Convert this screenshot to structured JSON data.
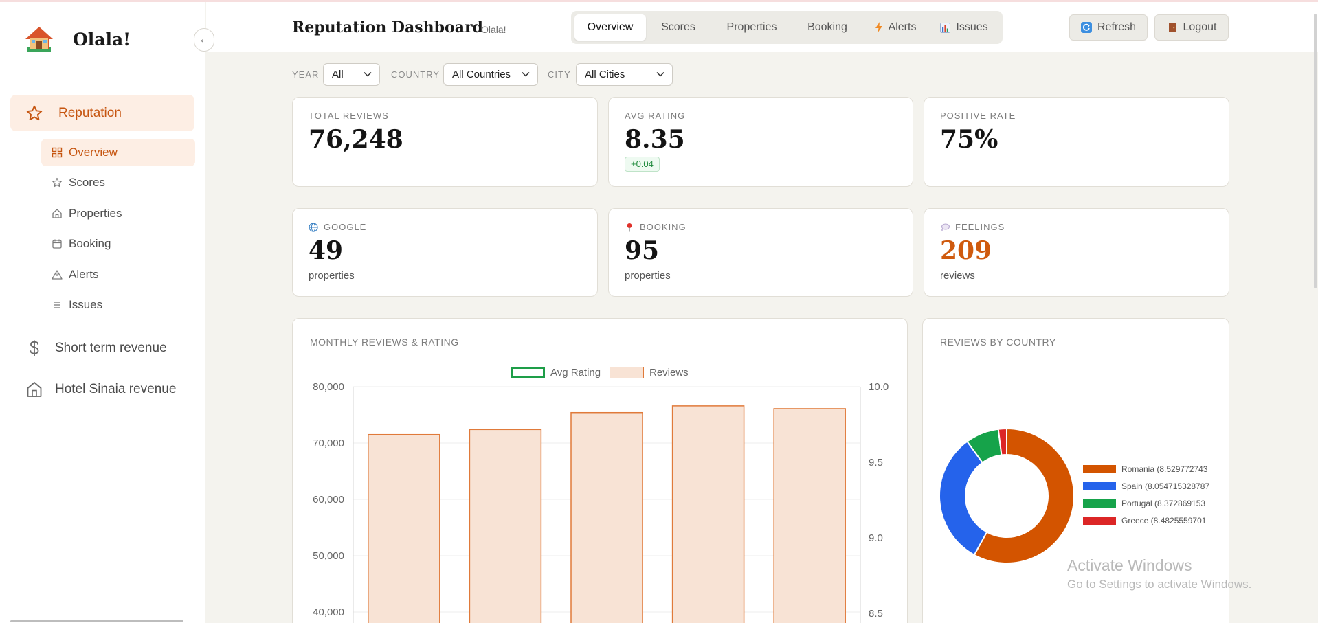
{
  "app": {
    "name": "Olala!"
  },
  "sidebar": {
    "collapse_glyph": "←",
    "group": {
      "label": "Reputation",
      "icon": "star-icon"
    },
    "sub_items": [
      {
        "label": "Overview",
        "icon": "grid-icon",
        "active": true
      },
      {
        "label": "Scores",
        "icon": "star-icon"
      },
      {
        "label": "Properties",
        "icon": "home-icon"
      },
      {
        "label": "Booking",
        "icon": "calendar-icon"
      },
      {
        "label": "Alerts",
        "icon": "warning-icon"
      },
      {
        "label": "Issues",
        "icon": "list-icon"
      }
    ],
    "main_items": [
      {
        "label": "Short term revenue",
        "icon": "dollar-icon"
      },
      {
        "label": "Hotel Sinaia revenue",
        "icon": "home-icon"
      }
    ]
  },
  "header": {
    "title": "Reputation Dashboard",
    "subtitle": "Olala!",
    "tabs": [
      {
        "label": "Overview",
        "active": true
      },
      {
        "label": "Scores"
      },
      {
        "label": "Properties"
      },
      {
        "label": "Booking"
      },
      {
        "label": "Alerts",
        "icon": "bolt-icon"
      },
      {
        "label": "Issues",
        "icon": "bar-chart-icon"
      }
    ],
    "refresh_label": "Refresh",
    "logout_label": "Logout"
  },
  "filters": {
    "year": {
      "label": "YEAR",
      "value": "All"
    },
    "country": {
      "label": "COUNTRY",
      "value": "All Countries"
    },
    "city": {
      "label": "CITY",
      "value": "All Cities"
    }
  },
  "stats": {
    "total_reviews": {
      "label": "TOTAL REVIEWS",
      "value": "76,248"
    },
    "avg_rating": {
      "label": "AVG RATING",
      "value": "8.35",
      "delta": "+0.04"
    },
    "positive_rate": {
      "label": "POSITIVE RATE",
      "value": "75%"
    },
    "google": {
      "label": "GOOGLE",
      "value": "49",
      "unit": "properties"
    },
    "booking": {
      "label": "BOOKING",
      "value": "95",
      "unit": "properties"
    },
    "feelings": {
      "label": "FEELINGS",
      "value": "209",
      "unit": "reviews"
    }
  },
  "colors": {
    "accent": "#cf5a0e",
    "bar_fill": "#f8e3d5",
    "bar_stroke": "#e07a3a",
    "avg_line": "#1e9e48",
    "romania": "#d35400",
    "spain": "#2563eb",
    "portugal": "#16a34a",
    "greece": "#dc2626"
  },
  "chart_data": [
    {
      "type": "bar",
      "title": "MONTHLY REVIEWS & RATING",
      "legend": [
        "Avg Rating",
        "Reviews"
      ],
      "legend_position": "top",
      "series": [
        {
          "name": "Reviews",
          "values": [
            71500,
            72400,
            75400,
            76600,
            76100
          ]
        }
      ],
      "y_left": {
        "ticks": [
          "80,000",
          "70,000",
          "60,000",
          "50,000",
          "40,000"
        ],
        "visible_range": [
          40000,
          80000
        ]
      },
      "y_right": {
        "ticks": [
          "10.0",
          "9.5",
          "9.0",
          "8.5"
        ],
        "visible_range": [
          8.5,
          10.0
        ]
      },
      "grid": true
    },
    {
      "type": "pie",
      "title": "REVIEWS BY COUNTRY",
      "slices": [
        {
          "label": "Romania (8.529772743",
          "value": 58
        },
        {
          "label": "Spain (8.054715328787",
          "value": 32
        },
        {
          "label": "Portugal (8.372869153",
          "value": 8
        },
        {
          "label": "Greece (8.4825559701",
          "value": 2
        }
      ]
    }
  ],
  "watermark": {
    "line1": "Activate Windows",
    "line2": "Go to Settings to activate Windows."
  }
}
